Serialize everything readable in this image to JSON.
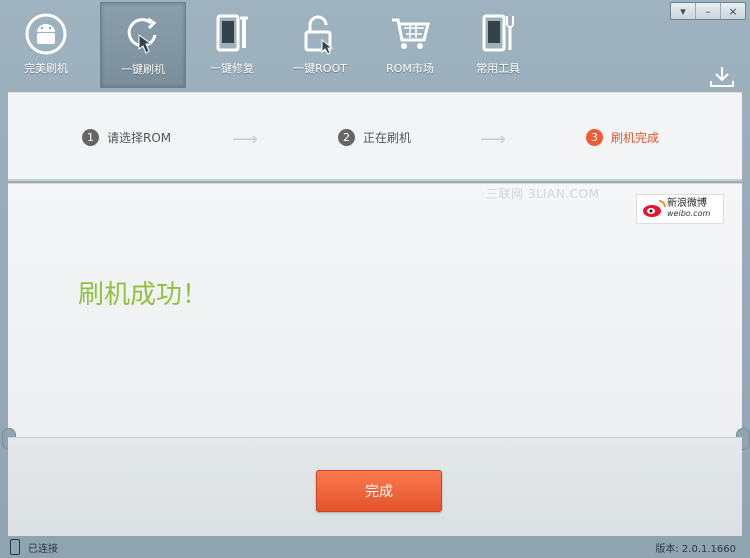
{
  "toolbar": {
    "items": [
      {
        "label": "完美刷机",
        "icon": "android-icon",
        "active": false
      },
      {
        "label": "一键刷机",
        "icon": "touch-refresh-icon",
        "active": true
      },
      {
        "label": "一键修复",
        "icon": "tablet-wrench-icon",
        "active": false
      },
      {
        "label": "一键ROOT",
        "icon": "unlock-icon",
        "active": false
      },
      {
        "label": "ROM市场",
        "icon": "cart-icon",
        "active": false
      },
      {
        "label": "常用工具",
        "icon": "tools-icon",
        "active": false
      }
    ]
  },
  "window_controls": {
    "menu": "▾",
    "minimize": "–",
    "close": "×"
  },
  "steps": [
    {
      "num": "1",
      "label": "请选择ROM",
      "state": "done"
    },
    {
      "num": "2",
      "label": "正在刷机",
      "state": "done"
    },
    {
      "num": "3",
      "label": "刷机完成",
      "state": "current"
    }
  ],
  "content": {
    "watermark": "三联网 3LIAN.COM",
    "weibo": {
      "cn": "新浪微博",
      "en": "weibo.com"
    },
    "success_text": "刷机成功！"
  },
  "done_button": "完成",
  "status": {
    "connection": "已连接",
    "version": "版本: 2.0.1.1660"
  },
  "colors": {
    "accent": "#ef5c2f",
    "success": "#92c13f",
    "frame": "#8fa4b0"
  }
}
